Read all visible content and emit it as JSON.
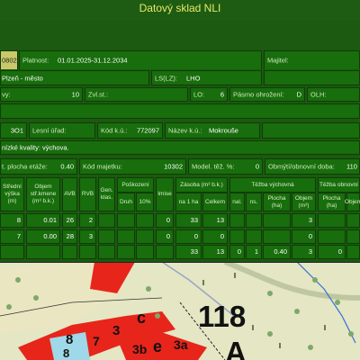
{
  "app_title": "Datový sklad NLI",
  "row1": {
    "code": "0802",
    "platnost_label": "Platnost:",
    "platnost_value": "01.01.2025-31.12.2034",
    "majitel_label": "Majitel:"
  },
  "row2": {
    "place": "Plzeň - město",
    "ls_label": "LS(LZ):",
    "ls_value": "LHO"
  },
  "row3": {
    "vy_label": "vy:",
    "vy_value": "10",
    "zvl_label": "Zvl.st.:",
    "lo_label": "LO:",
    "lo_value": "6",
    "pasmo_label": "Pásmo ohrožení:",
    "pasmo_value": "D",
    "olh_label": "OLH:"
  },
  "row4": {
    "code": "3O1",
    "lesni_label": "Lesní úřad:",
    "kod_ku_label": "Kód k.ú.:",
    "kod_ku_value": "772097",
    "nazev_ku_label": "Název k.ú.:",
    "nazev_ku_value": "Mokrouše"
  },
  "row5": {
    "text": "nízké kvality: výchova."
  },
  "row6": {
    "plocha_label": "t. plocha etáže:",
    "plocha_value": "0.40",
    "kod_majetku_label": "Kód majetku:",
    "kod_majetku_value": "10302",
    "model_label": "Model. těž. %:",
    "model_value": "0",
    "obmyti_label": "Obmýtí/obnovní doba:",
    "obmyti_value": "110"
  },
  "table": {
    "headers": {
      "stredni_vyska": "Střední výška (m)",
      "objem": "Objem stř.kmene (m³ b.k.)",
      "avb": "AVB",
      "rvb": "RVB",
      "gen_klas": "Gen. klas.",
      "poskozeni": "Poškození",
      "druh": "Druh",
      "pct10": "10%",
      "imise": "Imise",
      "zasoba": "Zásoba (m³ b.k.)",
      "na1ha": "na 1 ha",
      "celkem": "Celkem",
      "tezba_vychovna": "Těžba výchovná",
      "nal": "nal.",
      "ns": "ns.",
      "plocha_ha": "Plocha (ha)",
      "objem_m3": "Objem (m³)",
      "tezba_obnovni": "Těžba obnovní",
      "plocha_ha2": "Plocha (ha)",
      "objem2": "Objem"
    },
    "rows": [
      [
        "8",
        "0.01",
        "26",
        "2",
        "",
        "",
        "",
        "0",
        "33",
        "13",
        "",
        "",
        "",
        "3",
        "",
        ""
      ],
      [
        "7",
        "0.00",
        "28",
        "3",
        "",
        "",
        "",
        "0",
        "0",
        "0",
        "",
        "",
        "",
        "0",
        "",
        ""
      ],
      [
        "",
        "",
        "",
        "",
        "",
        "",
        "",
        "",
        "33",
        "13",
        "0",
        "1",
        "0.40",
        "3",
        "0",
        ""
      ]
    ]
  },
  "map": {
    "label_118": "118",
    "label_a": "A",
    "label_c": "c",
    "label_3": "3",
    "label_3be": "3b",
    "label_e": "e",
    "label_3a": "3a",
    "label_8": "8",
    "label_7": "7",
    "label_8b": "8"
  },
  "colors": {
    "panel_bg": "#1b5a10",
    "cell_bg": "#186d0c",
    "title_color": "#e9e76a",
    "map_bg": "#e6e7c9",
    "map_red": "#e8251b"
  }
}
